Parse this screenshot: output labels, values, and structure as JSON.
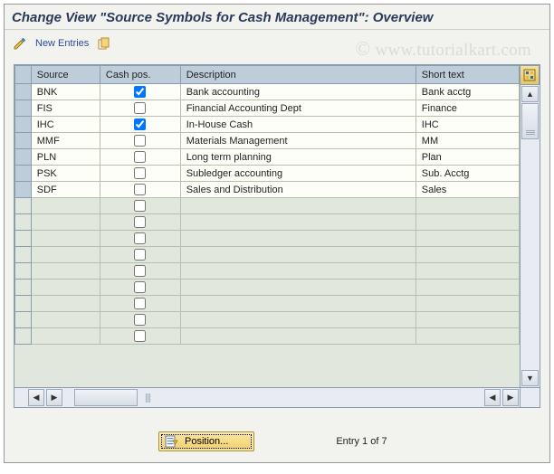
{
  "title": "Change View \"Source Symbols for Cash Management\": Overview",
  "watermark": "© www.tutorialkart.com",
  "toolbar": {
    "new_entries": "New Entries"
  },
  "columns": {
    "source": "Source",
    "cash_pos": "Cash pos.",
    "description": "Description",
    "short_text": "Short text"
  },
  "rows": [
    {
      "source": "BNK",
      "cash": true,
      "desc": "Bank accounting",
      "short": "Bank acctg"
    },
    {
      "source": "FIS",
      "cash": false,
      "desc": "Financial Accounting Dept",
      "short": "Finance"
    },
    {
      "source": "IHC",
      "cash": true,
      "desc": "In-House Cash",
      "short": "IHC"
    },
    {
      "source": "MMF",
      "cash": false,
      "desc": "Materials Management",
      "short": "MM"
    },
    {
      "source": "PLN",
      "cash": false,
      "desc": "Long term planning",
      "short": "Plan"
    },
    {
      "source": "PSK",
      "cash": false,
      "desc": "Subledger accounting",
      "short": "Sub. Acctg"
    },
    {
      "source": "SDF",
      "cash": false,
      "desc": "Sales and Distribution",
      "short": "Sales"
    }
  ],
  "footer": {
    "position_label": "Position...",
    "entry_text": "Entry 1 of 7"
  },
  "empty_rows": 9
}
